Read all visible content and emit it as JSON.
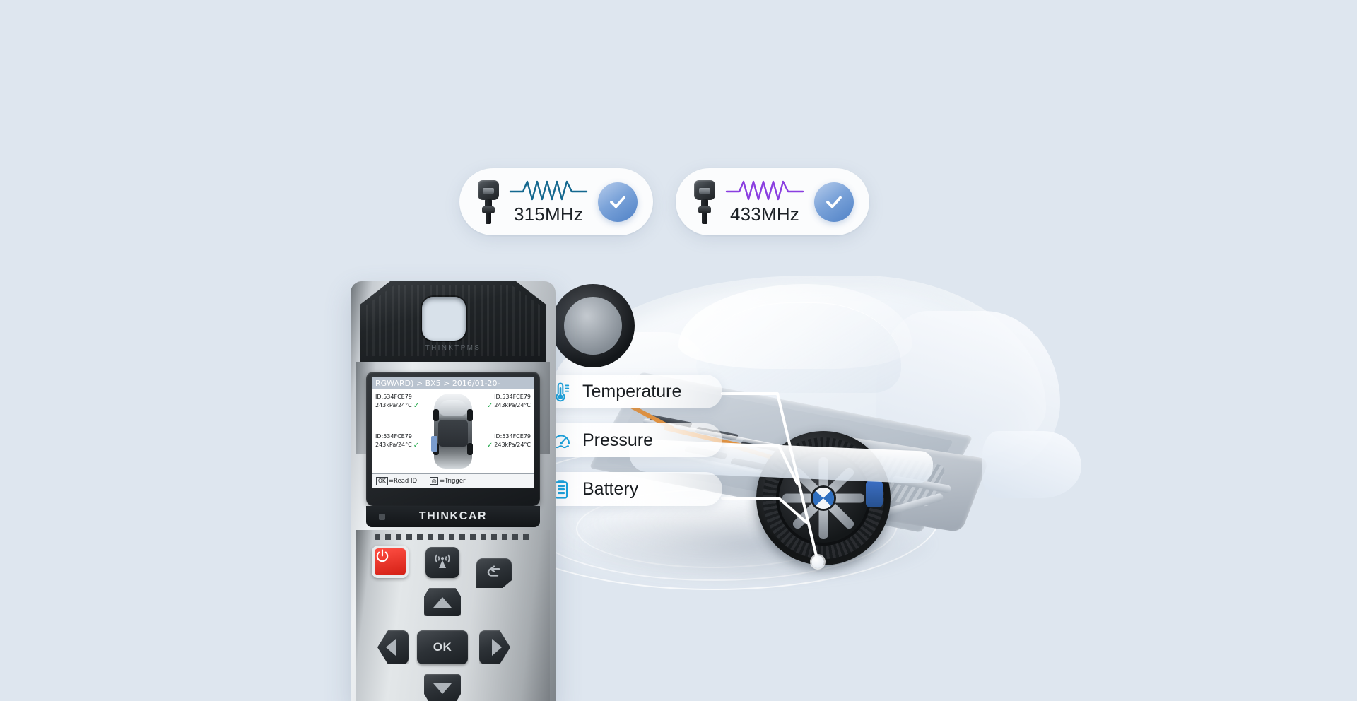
{
  "background_color": "#dee6ef",
  "frequency_badges": [
    {
      "sensor_icon": "tpms-sensor-icon",
      "wave_icon": "waveform-icon",
      "wave_color": "#14688f",
      "label": "315MHz",
      "status_icon": "check-circle-icon",
      "status_color": "#5a8fd0"
    },
    {
      "sensor_icon": "tpms-sensor-icon",
      "wave_icon": "waveform-icon",
      "wave_color": "#8a3ee0",
      "label": "433MHz",
      "status_icon": "check-circle-icon",
      "status_color": "#5a8fd0"
    }
  ],
  "feature_pills": [
    {
      "icon": "thermometer-icon",
      "label": "Temperature",
      "icon_color": "#17a1dc"
    },
    {
      "icon": "gauge-icon",
      "label": "Pressure",
      "icon_color": "#17a1dc"
    },
    {
      "icon": "battery-icon",
      "label": "Battery",
      "icon_color": "#17a1dc"
    }
  ],
  "device": {
    "top_brand": "THINKTPMS",
    "brand": "THINKCAR",
    "screen": {
      "breadcrumb": "RGWARD) > BX5 > 2016/01-20-",
      "sensors": [
        {
          "position": "front-left",
          "id": "ID:534FCE79",
          "reading": "243kPa/24°C",
          "status": "ok"
        },
        {
          "position": "front-right",
          "id": "ID:534FCE79",
          "reading": "243kPa/24°C",
          "status": "ok"
        },
        {
          "position": "rear-left",
          "id": "ID:534FCE79",
          "reading": "243kPa/24°C",
          "status": "ok"
        },
        {
          "position": "rear-right",
          "id": "ID:534FCE79",
          "reading": "243kPa/24°C",
          "status": "ok"
        }
      ],
      "footer": {
        "ok_key": "OK",
        "ok_action": "=Read ID",
        "trigger_key": "◎",
        "trigger_action": "=Trigger"
      }
    },
    "keys": [
      {
        "name": "power-button",
        "label": "⏻"
      },
      {
        "name": "trigger-button",
        "label": "((•))"
      },
      {
        "name": "back-button",
        "label": "↶"
      },
      {
        "name": "up-button",
        "label": "▲"
      },
      {
        "name": "left-button",
        "label": "◀"
      },
      {
        "name": "ok-button",
        "label": "OK"
      },
      {
        "name": "right-button",
        "label": "▶"
      },
      {
        "name": "down-button",
        "label": "▼"
      }
    ]
  }
}
